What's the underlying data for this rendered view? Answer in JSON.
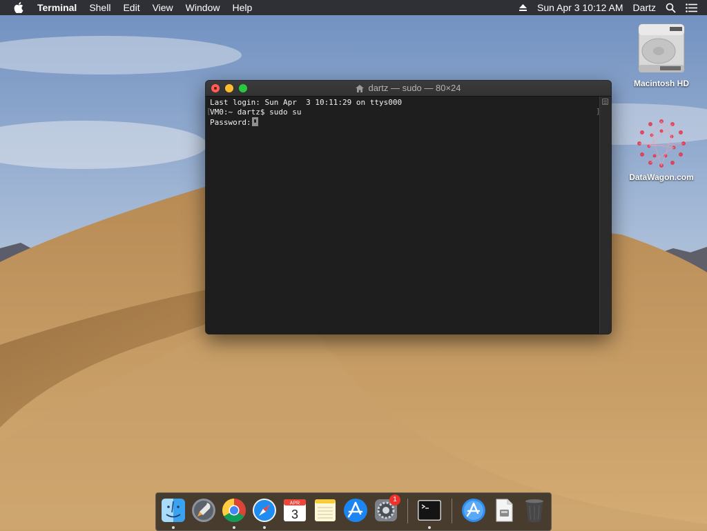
{
  "menubar": {
    "app_name": "Terminal",
    "menus": [
      "Shell",
      "Edit",
      "View",
      "Window",
      "Help"
    ],
    "clock": "Sun Apr 3  10:12 AM",
    "user": "Dartz"
  },
  "desktop": {
    "icons": [
      {
        "label": "Macintosh HD",
        "icon": "hard-drive-icon"
      },
      {
        "label": "DataWagon.com",
        "icon": "datawagon-logo-icon"
      }
    ]
  },
  "terminal": {
    "title": "dartz — sudo — 80×24",
    "lines": [
      "Last login: Sun Apr  3 10:11:29 on ttys000",
      "VM0:~ dartz$ sudo su",
      "Password:"
    ]
  },
  "dock": {
    "items": [
      {
        "name": "finder-icon",
        "running": true
      },
      {
        "name": "launchpad-icon",
        "running": false
      },
      {
        "name": "chrome-icon",
        "running": true
      },
      {
        "name": "safari-icon",
        "running": true
      },
      {
        "name": "calendar-icon",
        "month": "APR",
        "day": "3",
        "running": false
      },
      {
        "name": "notes-icon",
        "running": false
      },
      {
        "name": "app-store-icon",
        "running": false
      },
      {
        "name": "system-preferences-icon",
        "badge": "1",
        "running": false
      },
      {
        "name": "terminal-icon",
        "running": true
      },
      {
        "name": "applications-folder-icon",
        "running": false
      },
      {
        "name": "document-stack-icon",
        "running": false
      },
      {
        "name": "trash-icon",
        "running": false
      }
    ]
  },
  "colors": {
    "menubar_bg": "#28282a",
    "terminal_bg": "#1e1e1e",
    "close": "#fd5f57",
    "minimize": "#febc2e",
    "maximize": "#28c840",
    "badge": "#f0312b"
  }
}
